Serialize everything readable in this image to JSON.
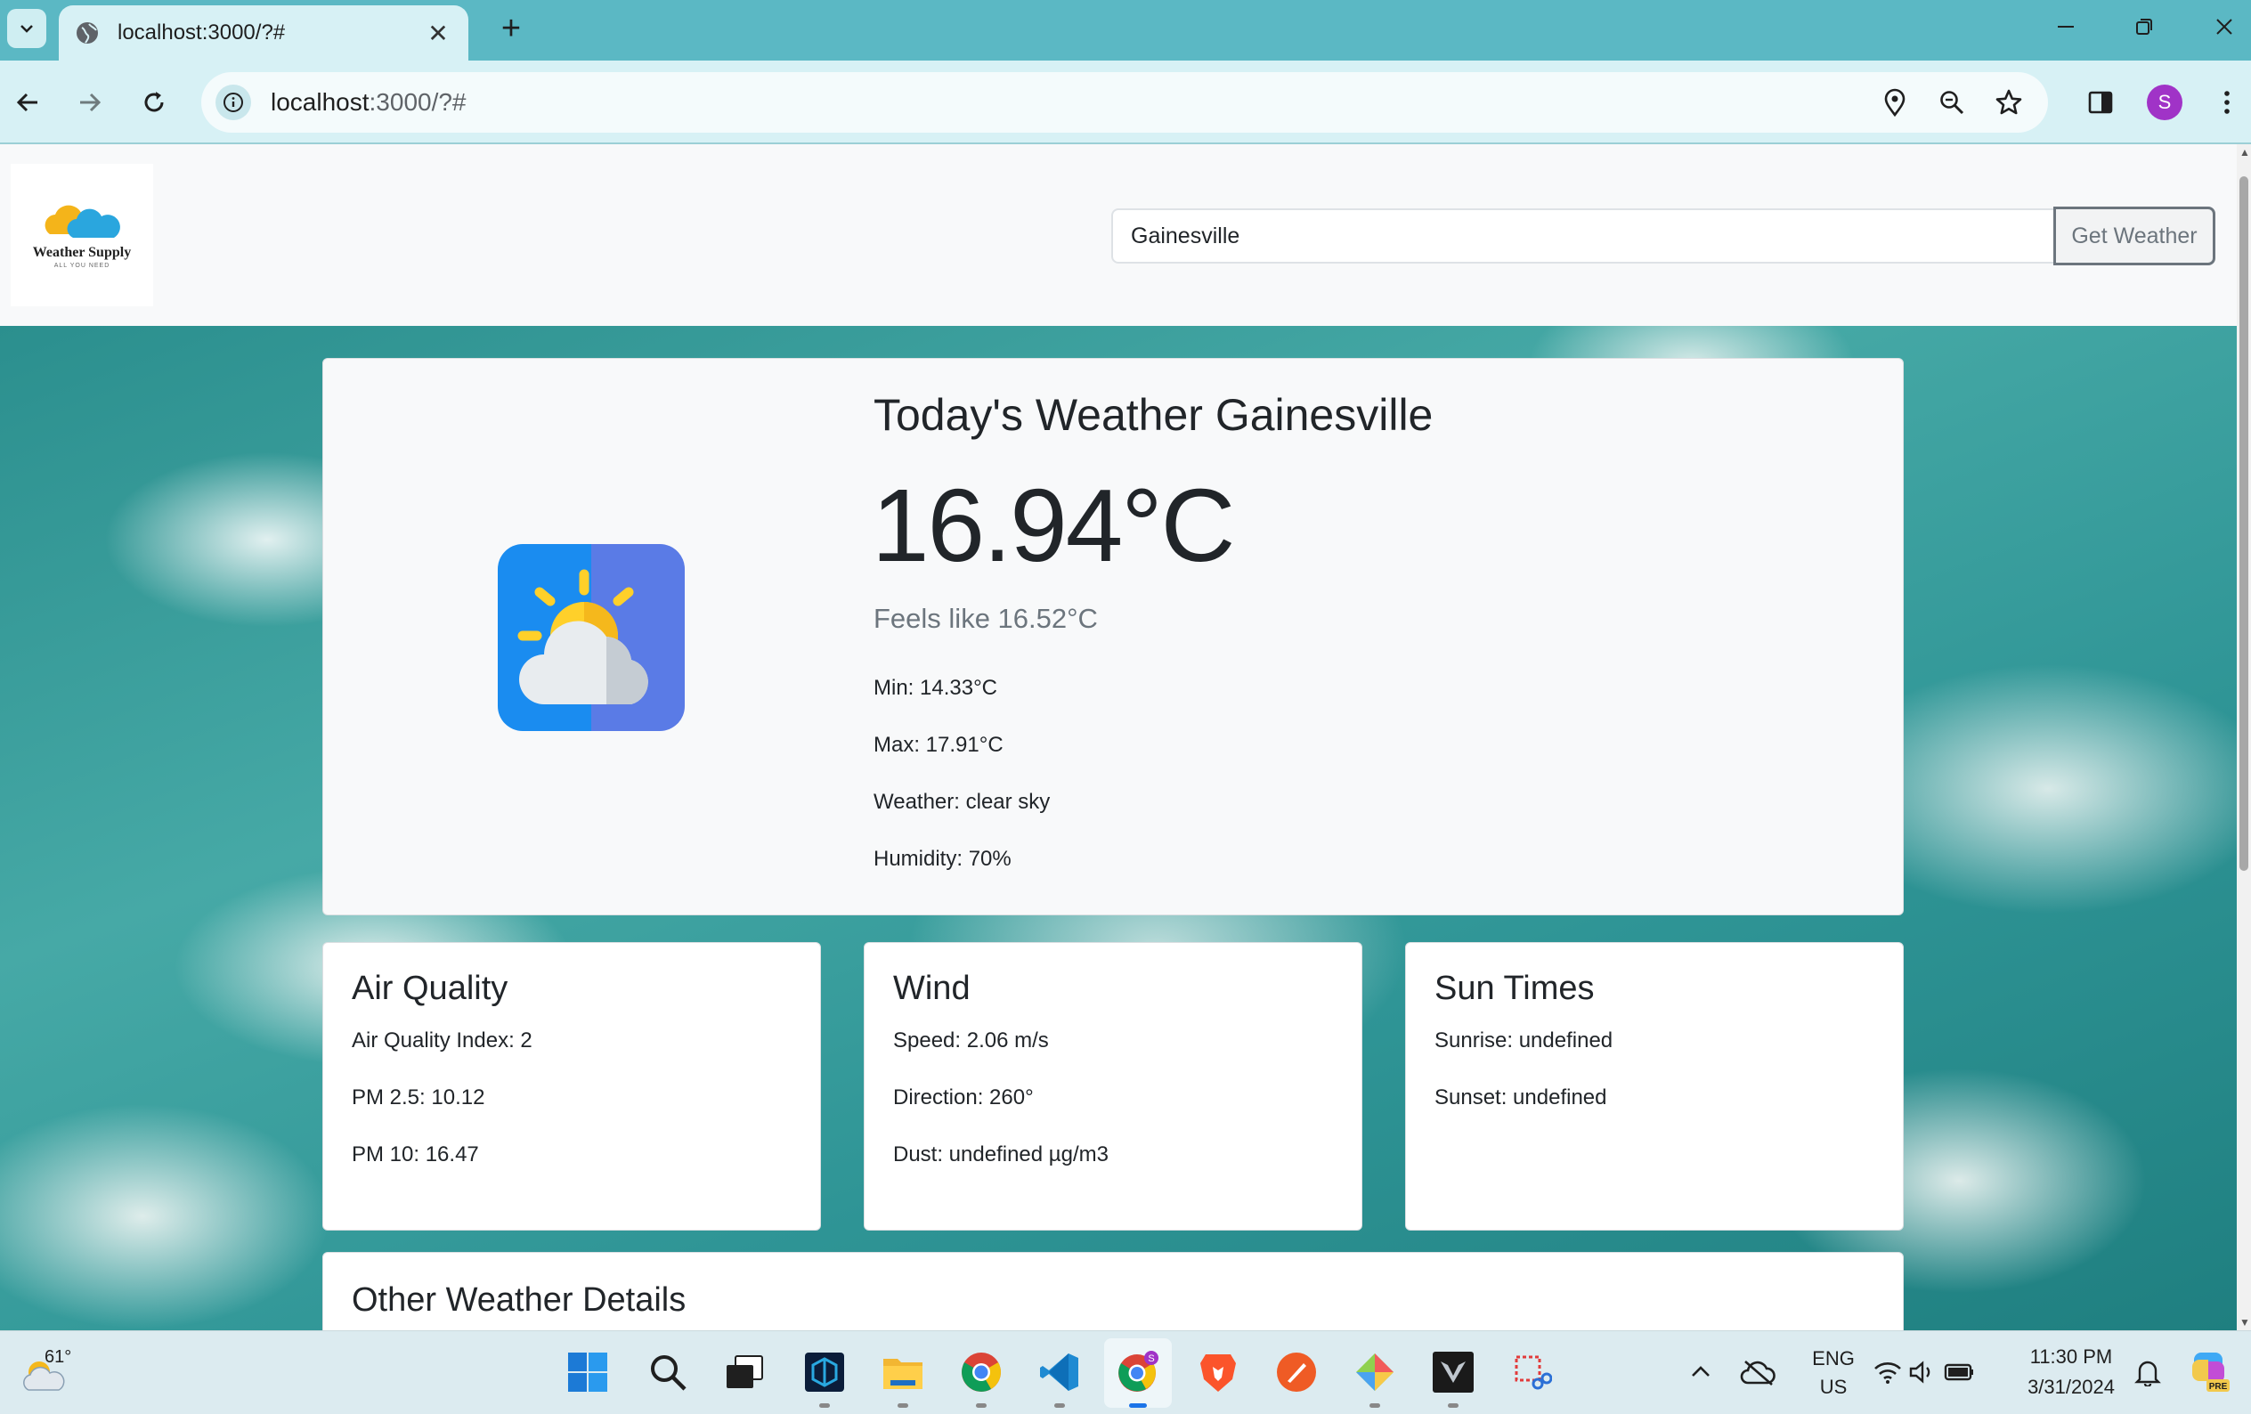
{
  "browser": {
    "tab_title": "localhost:3000/?#",
    "url_host": "localhost",
    "url_rest": ":3000/?#",
    "profile_initial": "S"
  },
  "header": {
    "logo_name": "Weather Supply",
    "logo_tagline": "ALL YOU NEED",
    "search_value": "Gainesville",
    "search_button": "Get Weather"
  },
  "today": {
    "title": "Today's Weather Gainesville",
    "temperature": "16.94°C",
    "feels_like": "Feels like 16.52°C",
    "min": "Min: 14.33°C",
    "max": "Max: 17.91°C",
    "weather": "Weather: clear sky",
    "humidity": "Humidity: 70%"
  },
  "air_quality": {
    "title": "Air Quality",
    "index": "Air Quality Index: 2",
    "pm25": "PM 2.5: 10.12",
    "pm10": "PM 10: 16.47"
  },
  "wind": {
    "title": "Wind",
    "speed": "Speed: 2.06 m/s",
    "direction": "Direction: 260°",
    "dust": "Dust: undefined µg/m3"
  },
  "sun_times": {
    "title": "Sun Times",
    "sunrise": "Sunrise: undefined",
    "sunset": "Sunset: undefined"
  },
  "other": {
    "title": "Other Weather Details"
  },
  "taskbar": {
    "weather_temp": "61°",
    "lang_top": "ENG",
    "lang_bottom": "US",
    "time": "11:30 PM",
    "date": "3/31/2024",
    "copilot_badge": "PRE"
  },
  "colors": {
    "tabstrip": "#5bb8c4",
    "toolbar": "#d7f1f5",
    "card_bg": "#f8f9fa",
    "sky": "#3aa0a0"
  }
}
